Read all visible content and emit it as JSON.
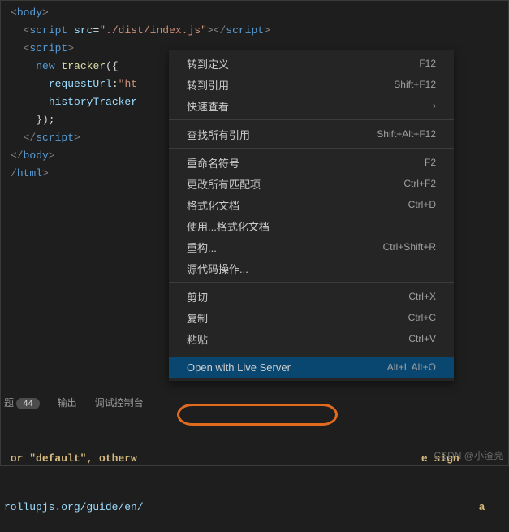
{
  "code": {
    "l1a": "<",
    "l1b": "body",
    "l1c": ">",
    "l2a": "  <",
    "l2b": "script",
    "l2c": " ",
    "l2d": "src",
    "l2e": "=",
    "l2f": "\"./dist/index.js\"",
    "l2g": "></",
    "l2h": "script",
    "l2i": ">",
    "l3a": "  <",
    "l3b": "script",
    "l3c": ">",
    "l4a": "    ",
    "l4b": "new",
    "l4c": " ",
    "l4d": "tracker",
    "l4e": "({",
    "l5a": "      ",
    "l5b": "requestUrl",
    "l5c": ":",
    "l5d": "\"ht",
    "l6a": "      ",
    "l6b": "historyTracker",
    "l7a": "    });",
    "l8a": "  </",
    "l8b": "script",
    "l8c": ">",
    "l9a": "</",
    "l9b": "body",
    "l9c": ">",
    "l10a": "/",
    "l10b": "html",
    "l10c": ">"
  },
  "menu": {
    "items": [
      {
        "label": "转到定义",
        "shortcut": "F12"
      },
      {
        "label": "转到引用",
        "shortcut": "Shift+F12"
      },
      {
        "label": "快速查看",
        "shortcut": "",
        "submenu": true
      },
      {
        "sep": true
      },
      {
        "label": "查找所有引用",
        "shortcut": "Shift+Alt+F12"
      },
      {
        "sep": true
      },
      {
        "label": "重命名符号",
        "shortcut": "F2"
      },
      {
        "label": "更改所有匹配项",
        "shortcut": "Ctrl+F2"
      },
      {
        "label": "格式化文档",
        "shortcut": "Ctrl+D"
      },
      {
        "label": "使用...格式化文档",
        "shortcut": ""
      },
      {
        "label": "重构...",
        "shortcut": "Ctrl+Shift+R"
      },
      {
        "label": "源代码操作...",
        "shortcut": ""
      },
      {
        "sep": true
      },
      {
        "label": "剪切",
        "shortcut": "Ctrl+X"
      },
      {
        "label": "复制",
        "shortcut": "Ctrl+C"
      },
      {
        "label": "粘贴",
        "shortcut": "Ctrl+V"
      },
      {
        "sep": true
      },
      {
        "label": "Open with Live Server",
        "shortcut": "Alt+L Alt+O",
        "highlight": true
      }
    ]
  },
  "terminal": {
    "tabs": {
      "problems": "题",
      "count": "44",
      "output": "输出",
      "debug": "调试控制台"
    },
    "line1a": " or ",
    "line1b": "\"default\"",
    "line1c": ", otherw",
    "line1d": "e sign",
    "line2a": "rollupjs.org/guide/en/",
    "line2b": "a"
  },
  "watermark": "CSDN @小渣亮"
}
